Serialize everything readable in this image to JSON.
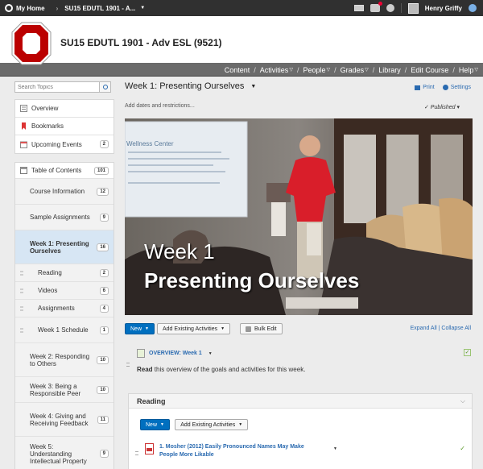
{
  "topbar": {
    "home_label": "My Home",
    "course_crumb": "SU15 EDUTL 1901 - A...",
    "user_name": "Henry Griffy"
  },
  "header": {
    "course_title": "SU15 EDUTL 1901 - Adv ESL (9521)",
    "brand_color": "#bb0000"
  },
  "nav": {
    "items": [
      {
        "label": "Content",
        "dropdown": false
      },
      {
        "label": "Activities",
        "dropdown": true
      },
      {
        "label": "People",
        "dropdown": true
      },
      {
        "label": "Grades",
        "dropdown": true
      },
      {
        "label": "Library",
        "dropdown": false
      },
      {
        "label": "Edit Course",
        "dropdown": false
      },
      {
        "label": "Help",
        "dropdown": true
      }
    ]
  },
  "sidebar": {
    "search_placeholder": "Search Topics",
    "top_items": [
      {
        "label": "Overview",
        "badge": ""
      },
      {
        "label": "Bookmarks",
        "badge": ""
      },
      {
        "label": "Upcoming Events",
        "badge": "2"
      }
    ],
    "toc_label": "Table of Contents",
    "toc_badge": "101",
    "modules": [
      {
        "label": "Course Information",
        "badge": "12"
      },
      {
        "label": "Sample Assignments",
        "badge": "9"
      },
      {
        "label": "Week 1: Presenting Ourselves",
        "badge": "16"
      },
      {
        "label": "Reading",
        "badge": "2"
      },
      {
        "label": "Videos",
        "badge": "6"
      },
      {
        "label": "Assignments",
        "badge": "4"
      },
      {
        "label": "Week 1 Schedule",
        "badge": "1"
      },
      {
        "label": "Week 2: Responding to Others",
        "badge": "10"
      },
      {
        "label": "Week 3: Being a Responsible Peer",
        "badge": "10"
      },
      {
        "label": "Week 4: Giving and Receiving Feedback",
        "badge": "11"
      },
      {
        "label": "Week 5: Understanding Intellectual Property",
        "badge": "9"
      }
    ]
  },
  "main": {
    "week_title": "Week 1: Presenting Ourselves",
    "print_label": "Print",
    "settings_label": "Settings",
    "dates_label": "Add dates and restrictions...",
    "published_label": "Published",
    "hero_line1": "Week 1",
    "hero_line2": "Presenting Ourselves",
    "hero_screen_text": "Wellness Center",
    "new_label": "New",
    "add_existing_label": "Add Existing Activities",
    "bulk_edit_label": "Bulk Edit",
    "expand_all": "Expand All",
    "collapse_all": "Collapse All",
    "overview_title": "OVERVIEW: Week 1",
    "overview_bold": "Read",
    "overview_rest": " this overview of the goals and activities for this week.",
    "reading_heading": "Reading",
    "reading_item": "1. Mosher (2012) Easily Pronounced Names May Make People More Likable"
  }
}
